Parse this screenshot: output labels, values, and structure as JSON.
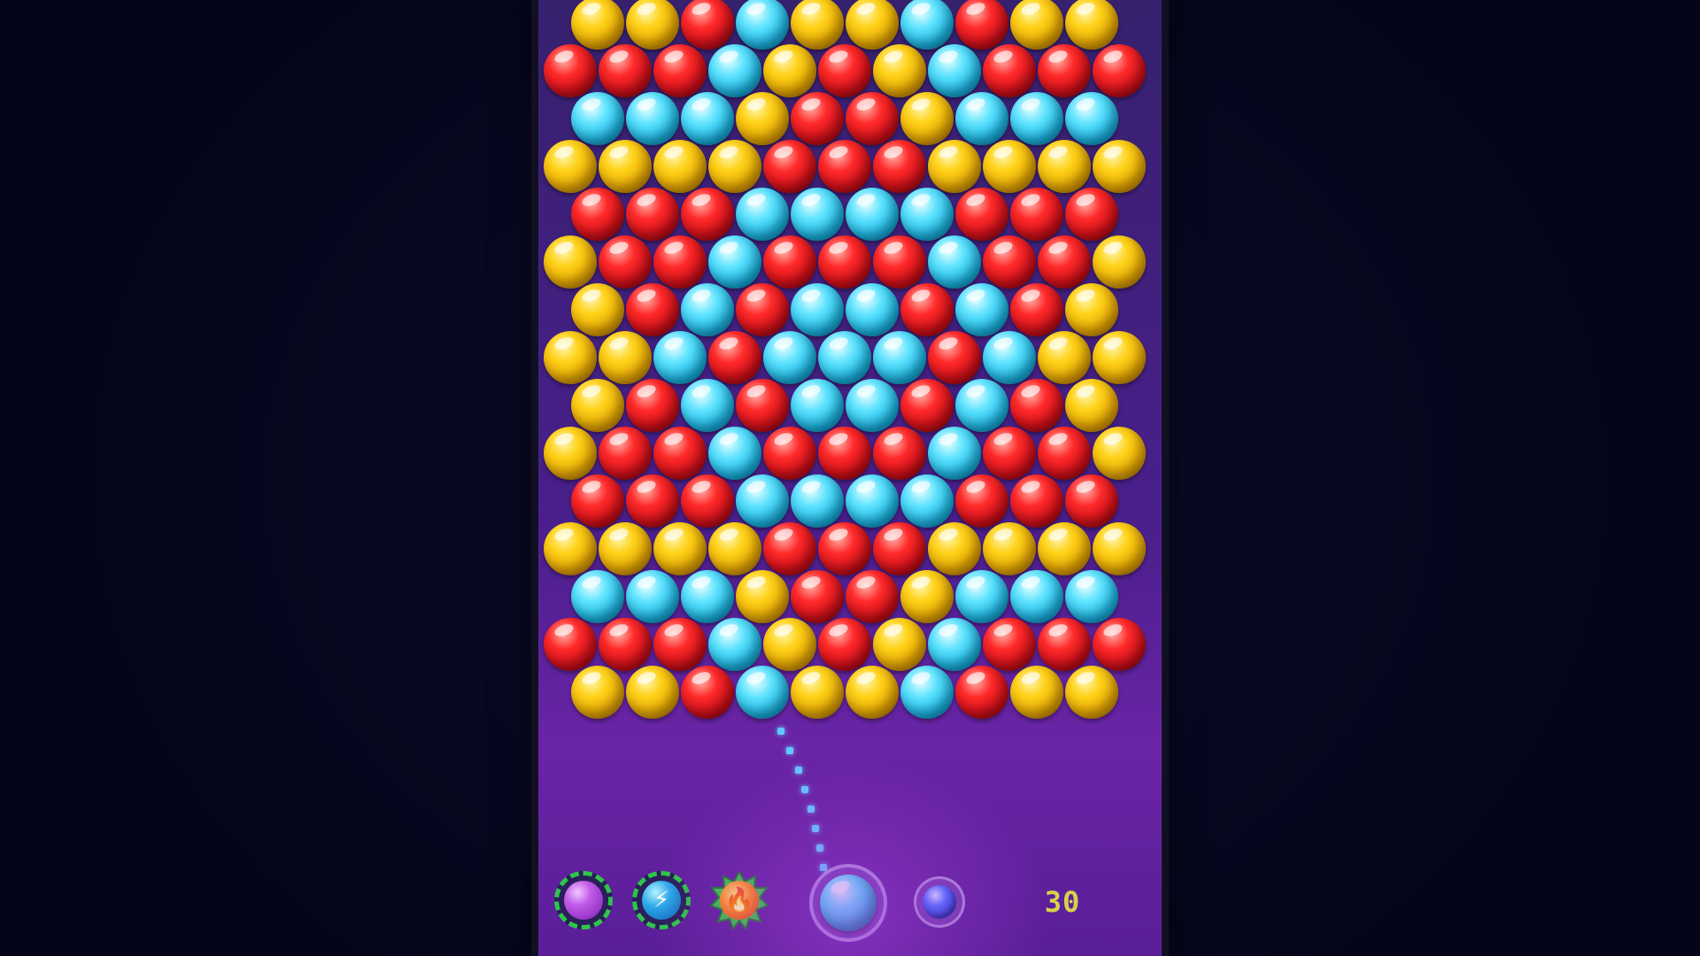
{
  "colors": {
    "yellow": "#ffd21a",
    "red": "#ff2a2a",
    "cyan": "#5fe3ff",
    "next_bubble": "#4a6cff",
    "booster_ring": "#2ec54a",
    "moves_text": "#d8d24a",
    "board_background": "#4a1f8c"
  },
  "board": {
    "rows": [
      [
        "Y",
        "Y",
        "R",
        "C",
        "Y",
        "Y",
        "C",
        "R",
        "Y",
        "Y"
      ],
      [
        "R",
        "R",
        "R",
        "C",
        "Y",
        "R",
        "Y",
        "C",
        "R",
        "R",
        "R"
      ],
      [
        "C",
        "C",
        "C",
        "Y",
        "R",
        "R",
        "Y",
        "C",
        "C",
        "C"
      ],
      [
        "Y",
        "Y",
        "Y",
        "Y",
        "R",
        "R",
        "R",
        "Y",
        "Y",
        "Y",
        "Y"
      ],
      [
        "R",
        "R",
        "R",
        "C",
        "C",
        "C",
        "C",
        "R",
        "R",
        "R"
      ],
      [
        "Y",
        "R",
        "R",
        "C",
        "R",
        "R",
        "R",
        "C",
        "R",
        "R",
        "Y"
      ],
      [
        "Y",
        "R",
        "C",
        "R",
        "C",
        "C",
        "R",
        "C",
        "R",
        "Y"
      ],
      [
        "Y",
        "Y",
        "C",
        "R",
        "C",
        "C",
        "C",
        "R",
        "C",
        "Y",
        "Y"
      ],
      [
        "Y",
        "R",
        "C",
        "R",
        "C",
        "C",
        "R",
        "C",
        "R",
        "Y"
      ],
      [
        "Y",
        "R",
        "R",
        "C",
        "R",
        "R",
        "R",
        "C",
        "R",
        "R",
        "Y"
      ],
      [
        "R",
        "R",
        "R",
        "C",
        "C",
        "C",
        "C",
        "R",
        "R",
        "R"
      ],
      [
        "Y",
        "Y",
        "Y",
        "Y",
        "R",
        "R",
        "R",
        "Y",
        "Y",
        "Y",
        "Y"
      ],
      [
        "C",
        "C",
        "C",
        "Y",
        "R",
        "R",
        "Y",
        "C",
        "C",
        "C"
      ],
      [
        "R",
        "R",
        "R",
        "C",
        "Y",
        "R",
        "Y",
        "C",
        "R",
        "R",
        "R"
      ],
      [
        "Y",
        "Y",
        "R",
        "C",
        "Y",
        "Y",
        "C",
        "R",
        "Y",
        "Y"
      ]
    ]
  },
  "hud": {
    "boosters": [
      {
        "name": "purple-bubble-booster",
        "icon": "purple-orb-icon"
      },
      {
        "name": "lightning-booster",
        "icon": "lightning-icon",
        "glyph": "⚡"
      },
      {
        "name": "fire-booster",
        "icon": "fire-icon",
        "glyph": "🔥"
      }
    ],
    "shooter_color": "cyan",
    "next_color": "blue",
    "moves_left": "30"
  }
}
